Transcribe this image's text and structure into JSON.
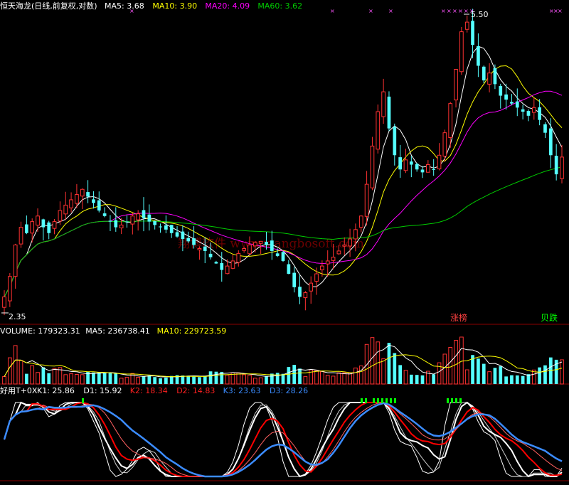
{
  "colors": {
    "bg": "#000000",
    "up": "#ff3232",
    "down": "#54ffff",
    "white": "#ffffff",
    "yellow": "#ffff00",
    "magenta": "#ff00ff",
    "green": "#00cc00",
    "red": "#ff0000",
    "blue": "#3b8cff",
    "divider": "#8b0000",
    "marker": "#ff55ff",
    "vol_green": "#00ff00"
  },
  "watermark": "翔博软件 www.xiangbosoft.com",
  "price_panel": {
    "title": "恒天海龙(日线,前复权,对数)",
    "indicators": [
      {
        "label": "MA5: 3.68",
        "color": "#ffffff"
      },
      {
        "label": "MA10: 3.90",
        "color": "#ffff00"
      },
      {
        "label": "MA20: 4.09",
        "color": "#ff00ff"
      },
      {
        "label": "MA60: 3.62",
        "color": "#00cc00"
      }
    ],
    "high_label": "5.50",
    "low_label": "2.35",
    "tags": [
      {
        "text": "涨榜",
        "color": "#ff4040"
      },
      {
        "text": "贝跌",
        "color": "#00ff00"
      }
    ]
  },
  "volume_panel": {
    "indicators": [
      {
        "label": "VOLUME: 179323.31",
        "color": "#ffffff"
      },
      {
        "label": "MA5: 236738.41",
        "color": "#ffffff"
      },
      {
        "label": "MA10: 229723.59",
        "color": "#ffff00"
      }
    ]
  },
  "kdj_panel": {
    "title": "好用T+0X",
    "indicators": [
      {
        "label": "K1: 25.86",
        "color": "#ffffff"
      },
      {
        "label": "D1: 15.92",
        "color": "#ffffff"
      },
      {
        "label": "K2: 18.34",
        "color": "#ff2020"
      },
      {
        "label": "D2: 14.83",
        "color": "#ff2020"
      },
      {
        "label": "K3: 23.63",
        "color": "#3b8cff"
      },
      {
        "label": "D3: 28.26",
        "color": "#3b8cff"
      }
    ]
  },
  "chart_data": {
    "type": "candlestick",
    "y_scale": "log",
    "ylim": [
      2.3,
      5.6
    ],
    "closes": [
      2.45,
      2.6,
      2.85,
      3.0,
      2.95,
      3.05,
      3.1,
      3.0,
      2.95,
      3.05,
      3.15,
      3.2,
      3.25,
      3.3,
      3.35,
      3.28,
      3.22,
      3.15,
      3.1,
      3.05,
      3.0,
      3.02,
      3.05,
      3.1,
      3.12,
      3.08,
      3.05,
      3.02,
      3.0,
      2.98,
      2.95,
      2.92,
      2.9,
      2.88,
      2.85,
      2.82,
      2.8,
      2.75,
      2.7,
      2.65,
      2.68,
      2.72,
      2.78,
      2.82,
      2.85,
      2.87,
      2.88,
      2.85,
      2.8,
      2.76,
      2.72,
      2.62,
      2.52,
      2.45,
      2.48,
      2.55,
      2.62,
      2.68,
      2.72,
      2.75,
      2.8,
      2.85,
      2.9,
      2.98,
      3.1,
      3.4,
      3.8,
      4.2,
      4.45,
      4.0,
      3.7,
      3.55,
      3.65,
      3.6,
      3.55,
      3.52,
      3.6,
      3.55,
      3.7,
      3.95,
      4.3,
      4.75,
      5.3,
      5.45,
      5.1,
      4.8,
      4.6,
      4.7,
      4.55,
      4.4,
      4.35,
      4.3,
      4.25,
      4.2,
      4.15,
      4.25,
      4.1,
      3.95,
      3.7,
      3.5,
      3.68
    ]
  }
}
